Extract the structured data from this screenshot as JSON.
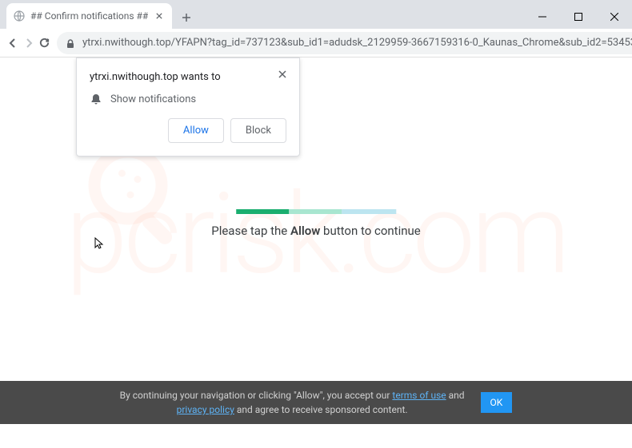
{
  "window": {
    "tab_title": "## Confirm notifications ##",
    "url": "ytrxi.nwithough.top/YFAPN?tag_id=737123&sub_id1=adudsk_2129959-3667159316-0_Kaunas_Chrome&sub_id2=53453..."
  },
  "permission_popup": {
    "origin": "ytrxi.nwithough.top wants to",
    "permission_label": "Show notifications",
    "allow_label": "Allow",
    "block_label": "Block"
  },
  "page": {
    "message_prefix": "Please tap the ",
    "message_bold": "Allow",
    "message_suffix": " button to continue"
  },
  "consent": {
    "text_before": "By continuing your navigation or clicking \"Allow\", you accept our ",
    "terms_link": "terms of use",
    "text_mid": " and ",
    "privacy_link": "privacy policy",
    "text_after": " and agree to receive sponsored content.",
    "ok_label": "OK"
  },
  "watermark": {
    "text": "pcrisk.com"
  }
}
